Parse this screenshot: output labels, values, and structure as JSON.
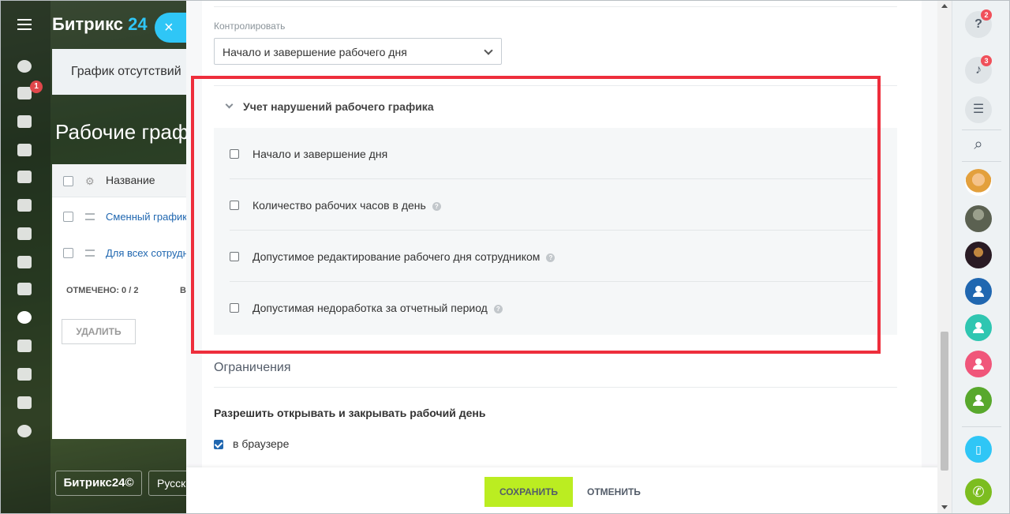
{
  "background": {
    "logo_main": "Битрикс",
    "logo_num": "24",
    "close_symbol": "×",
    "panel_title": "График отсутствий",
    "page_title": "Рабочие граф",
    "nav_badge": "1",
    "grid": {
      "header_label": "Название",
      "row1": "Сменный график",
      "row2": "Для всех сотрудн",
      "footer": "ОТМЕЧЕНО: 0 / 2",
      "footer_extra": "В",
      "delete_button": "УДАЛИТЬ"
    },
    "footer_logo": "Битрикс24©",
    "footer_lang": "Русск"
  },
  "form": {
    "control_label": "Контролировать",
    "control_value": "Начало и завершение рабочего дня",
    "violations_title": "Учет нарушений рабочего графика",
    "options": [
      {
        "label": "Начало и завершение дня",
        "help": false
      },
      {
        "label": "Количество рабочих часов в день",
        "help": true
      },
      {
        "label": "Допустимое редактирование рабочего дня сотрудником",
        "help": true
      },
      {
        "label": "Допустимая недоработка за отчетный период",
        "help": true
      }
    ],
    "restrictions_title": "Ограничения",
    "allow_title": "Разрешить открывать и закрывать рабочий день",
    "browser_label": "в браузере",
    "browser_checked": true,
    "help_symbol": "?"
  },
  "footer": {
    "save_label": "СОХРАНИТЬ",
    "cancel_label": "ОТМЕНИТЬ"
  },
  "right_bar": {
    "help_badge": "2",
    "notif_badge": "3",
    "help_glyph": "?",
    "search_glyph": "⌕"
  },
  "colors": {
    "accent": "#2fc6f6",
    "save": "#bbed21",
    "highlight": "#ee2e3c",
    "badge": "#f0505a"
  }
}
